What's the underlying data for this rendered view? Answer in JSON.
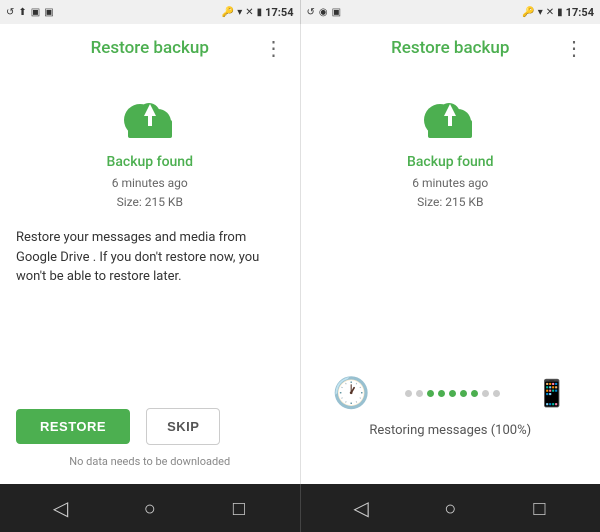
{
  "statusBar": {
    "leftIcons": [
      "↺",
      "⬆",
      "□",
      "□"
    ],
    "time": "17:54",
    "rightIcons": [
      "🔑",
      "▼",
      "✕",
      "🔋"
    ]
  },
  "leftScreen": {
    "title": "Restore backup",
    "menuIcon": "⋮",
    "cloudAlt": "cloud upload icon",
    "backupFoundLabel": "Backup found",
    "backupMeta1": "6 minutes ago",
    "backupMeta2": "Size: 215 KB",
    "description": "Restore your messages and media from Google Drive . If you don't restore now, you won't be able to restore later.",
    "restoreButton": "RESTORE",
    "skipButton": "SKIP",
    "noDownloadText": "No data needs to be downloaded"
  },
  "rightScreen": {
    "title": "Restore backup",
    "menuIcon": "⋮",
    "cloudAlt": "cloud upload icon",
    "backupFoundLabel": "Backup found",
    "backupMeta1": "6 minutes ago",
    "backupMeta2": "Size: 215 KB",
    "restoringText": "Restoring messages (100%)",
    "dots": [
      {
        "active": false
      },
      {
        "active": false
      },
      {
        "active": true
      },
      {
        "active": true
      },
      {
        "active": true
      },
      {
        "active": true
      },
      {
        "active": true
      },
      {
        "active": false
      },
      {
        "active": false
      }
    ]
  },
  "navBar": {
    "backIcon": "◁",
    "homeIcon": "○",
    "squareIcon": "□"
  }
}
